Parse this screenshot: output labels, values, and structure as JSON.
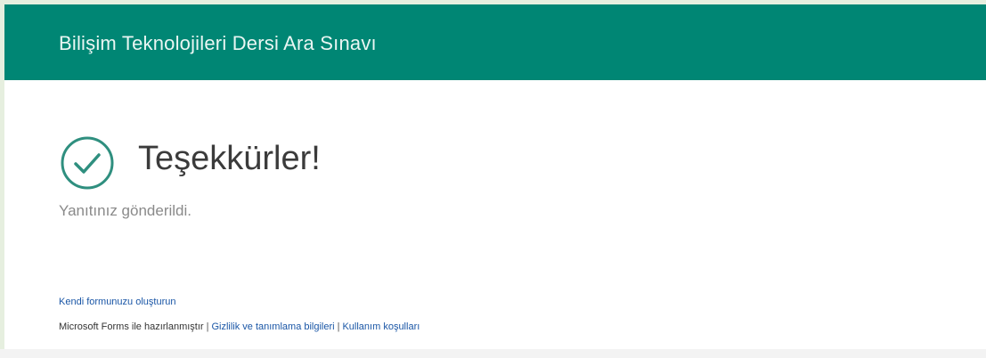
{
  "header": {
    "title": "Bilişim Teknolojileri Dersi Ara Sınavı",
    "color": "#008674"
  },
  "confirmation": {
    "icon": "check-circle-icon",
    "title": "Teşekkürler!",
    "message": "Yanıtınız gönderildi."
  },
  "links": {
    "create_form": "Kendi formunuzu oluşturun"
  },
  "footer": {
    "made_with": "Microsoft Forms ile hazırlanmıştır",
    "separator": "|",
    "privacy": "Gizlilik ve tanımlama bilgileri",
    "terms": "Kullanım koşulları"
  }
}
